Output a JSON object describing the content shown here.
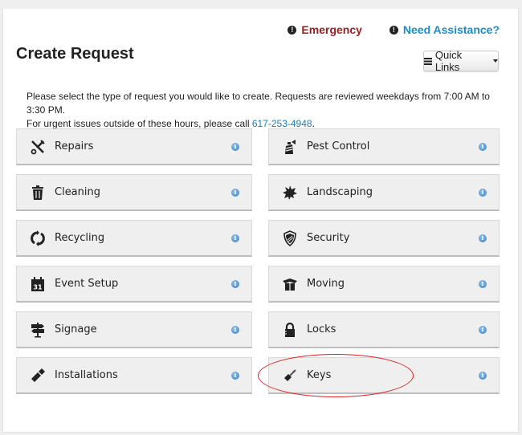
{
  "header": {
    "emergency_label": "Emergency",
    "assistance_label": "Need Assistance?",
    "title": "Create Request",
    "quick_links_label": "Quick Links"
  },
  "intro": {
    "line1": "Please select the type of request you would like to create. Requests are reviewed weekdays from 7:00 AM to 3:30 PM.",
    "line2_prefix": "For urgent issues outside of these hours, please call ",
    "phone": "617-253-4948",
    "line2_suffix": "."
  },
  "request_types": [
    {
      "label": "Repairs",
      "icon": "tools-icon"
    },
    {
      "label": "Pest Control",
      "icon": "spray-can-icon"
    },
    {
      "label": "Cleaning",
      "icon": "trash-icon"
    },
    {
      "label": "Landscaping",
      "icon": "leaf-icon"
    },
    {
      "label": "Recycling",
      "icon": "recycle-icon"
    },
    {
      "label": "Security",
      "icon": "shield-icon"
    },
    {
      "label": "Event Setup",
      "icon": "calendar-icon"
    },
    {
      "label": "Moving",
      "icon": "box-icon"
    },
    {
      "label": "Signage",
      "icon": "signpost-icon"
    },
    {
      "label": "Locks",
      "icon": "lock-icon"
    },
    {
      "label": "Installations",
      "icon": "hammer-icon"
    },
    {
      "label": "Keys",
      "icon": "key-icon"
    }
  ],
  "info_glyph": "i",
  "colors": {
    "emergency": "#9b1c1c",
    "link": "#1a8ccf",
    "annotation": "#e02020"
  }
}
